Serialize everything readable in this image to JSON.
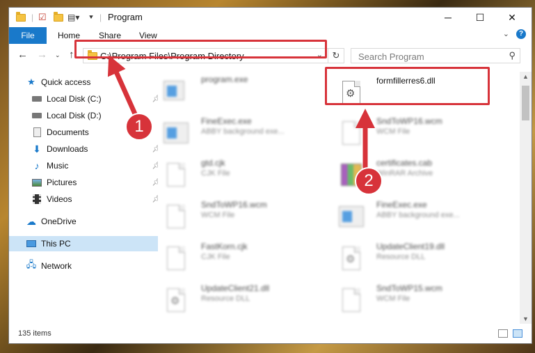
{
  "window": {
    "title": "Program"
  },
  "ribbon": {
    "tabs": [
      "File",
      "Home",
      "Share",
      "View"
    ],
    "help_label": "?"
  },
  "address": {
    "path": "C:\\Program Files\\Program Directory"
  },
  "search": {
    "placeholder": "Search Program"
  },
  "sidebar": {
    "items": [
      {
        "label": "Quick access",
        "icon": "star-icon"
      },
      {
        "label": "Local Disk (C:)",
        "icon": "drive-icon",
        "pinned": true
      },
      {
        "label": "Local Disk (D:)",
        "icon": "drive-icon"
      },
      {
        "label": "Documents",
        "icon": "documents-icon"
      },
      {
        "label": "Downloads",
        "icon": "download-icon",
        "pinned": true
      },
      {
        "label": "Music",
        "icon": "music-icon",
        "pinned": true
      },
      {
        "label": "Pictures",
        "icon": "pictures-icon",
        "pinned": true
      },
      {
        "label": "Videos",
        "icon": "videos-icon",
        "pinned": true
      },
      {
        "label": "OneDrive",
        "icon": "cloud-icon"
      },
      {
        "label": "This PC",
        "icon": "computer-icon",
        "selected": true
      },
      {
        "label": "Network",
        "icon": "network-icon"
      }
    ]
  },
  "files": [
    {
      "name": "program.exe",
      "desc": "",
      "type": "exe"
    },
    {
      "name": "formfillerres6.dll",
      "desc": "",
      "type": "dll"
    },
    {
      "name": "FineExec.exe",
      "desc": "ABBY background exe...",
      "type": "exe"
    },
    {
      "name": "SndToWP16.wcm",
      "desc": "WCM File",
      "type": "doc"
    },
    {
      "name": "gtd.cjk",
      "desc": "CJK File",
      "type": "doc"
    },
    {
      "name": "certificates.cab",
      "desc": "WinRAR Archive",
      "type": "cab"
    },
    {
      "name": "SndToWP16.wcm",
      "desc": "WCM File",
      "type": "doc"
    },
    {
      "name": "FineExec.exe",
      "desc": "ABBY background exe...",
      "type": "exe"
    },
    {
      "name": "FastKorn.cjk",
      "desc": "CJK File",
      "type": "doc"
    },
    {
      "name": "UpdateClient19.dll",
      "desc": "Resource DLL",
      "type": "dll"
    },
    {
      "name": "UpdateClient21.dll",
      "desc": "Resource DLL",
      "type": "dll"
    },
    {
      "name": "SndToWP15.wcm",
      "desc": "WCM File",
      "type": "doc"
    }
  ],
  "status": {
    "item_count": "135 items"
  },
  "callouts": [
    "1",
    "2"
  ],
  "colors": {
    "accent": "#1979ca",
    "highlight": "#d7333a",
    "selected": "#cce4f7"
  }
}
